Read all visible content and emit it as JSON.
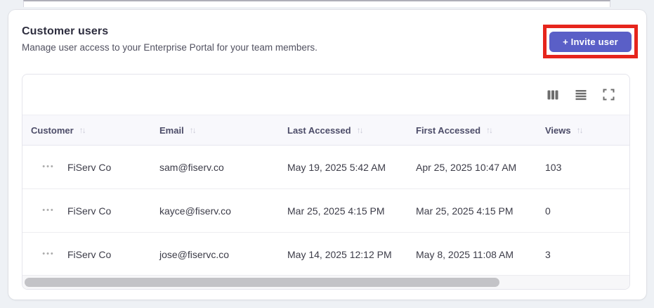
{
  "page": {
    "title": "Customer users",
    "subtitle": "Manage user access to your Enterprise Portal for your team members.",
    "accent_color": "#5a5fc7",
    "annotation_color": "#e6251c"
  },
  "header": {
    "invite_button_label": "+ Invite user"
  },
  "toolbar": {
    "icons": [
      "columns-icon",
      "density-icon",
      "fullscreen-icon"
    ]
  },
  "glyphs": {
    "sort": "↑↓",
    "row_menu": "•••"
  },
  "table": {
    "columns": [
      {
        "label": "Customer",
        "sortable": true
      },
      {
        "label": "Email",
        "sortable": true
      },
      {
        "label": "Last Accessed",
        "sortable": true
      },
      {
        "label": "First Accessed",
        "sortable": true
      },
      {
        "label": "Views",
        "sortable": true
      }
    ],
    "rows": [
      {
        "customer": "FiServ Co",
        "email": "sam@fiserv.co",
        "last_accessed": "May 19, 2025 5:42 AM",
        "first_accessed": "Apr 25, 2025 10:47 AM",
        "views": "103"
      },
      {
        "customer": "FiServ Co",
        "email": "kayce@fiserv.co",
        "last_accessed": "Mar 25, 2025 4:15 PM",
        "first_accessed": "Mar 25, 2025 4:15 PM",
        "views": "0"
      },
      {
        "customer": "FiServ Co",
        "email": "jose@fiservc.co",
        "last_accessed": "May 14, 2025 12:12 PM",
        "first_accessed": "May 8, 2025 11:08 AM",
        "views": "3"
      }
    ]
  }
}
